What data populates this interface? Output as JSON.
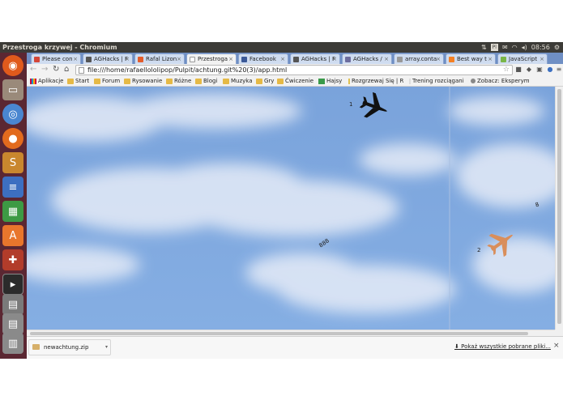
{
  "topbar": {
    "window_title": "Przestroga krzywej - Chromium",
    "pl_badge": "Pl",
    "clock": "08:56"
  },
  "tabs": [
    {
      "label": "Please con",
      "color": "#d44638"
    },
    {
      "label": "AGHacks | F",
      "color": "#555555"
    },
    {
      "label": "Rafal Lizon",
      "color": "#e45c2b"
    },
    {
      "label": "Przestroga",
      "color": "#ffffff"
    },
    {
      "label": "Facebook",
      "color": "#3b5998"
    },
    {
      "label": "AGHacks | F",
      "color": "#555555"
    },
    {
      "label": "AGHacks /",
      "color": "#6d6d9e"
    },
    {
      "label": "array.conta",
      "color": "#999999"
    },
    {
      "label": "Best way t",
      "color": "#f48024"
    },
    {
      "label": "JavaScript",
      "color": "#7ab648"
    }
  ],
  "address": {
    "url": "file:///home/rafaellololipop/Pulpit/achtung.git%20(3)/app.html"
  },
  "bookmarks": [
    {
      "label": "Aplikacje"
    },
    {
      "label": "Start"
    },
    {
      "label": "Forum"
    },
    {
      "label": "Rysowanie"
    },
    {
      "label": "Różne"
    },
    {
      "label": "Blogi"
    },
    {
      "label": "Muzyka"
    },
    {
      "label": "Gry"
    },
    {
      "label": "Ćwiczenie"
    },
    {
      "label": "Hajsy"
    },
    {
      "label": "Rozgrzewaj Się | R"
    },
    {
      "label": "Trening rozciągani"
    },
    {
      "label": "Zobacz: Eksperym"
    }
  ],
  "game": {
    "player1_label": "1",
    "player2_label": "2",
    "floating_text": "888",
    "side_mark": "8",
    "player1_color": "#111111",
    "player2_color": "#d98e5b"
  },
  "downloads": {
    "filename": "newachtung.zip",
    "show_all": "Pokaż wszystkie pobrane pliki..."
  }
}
